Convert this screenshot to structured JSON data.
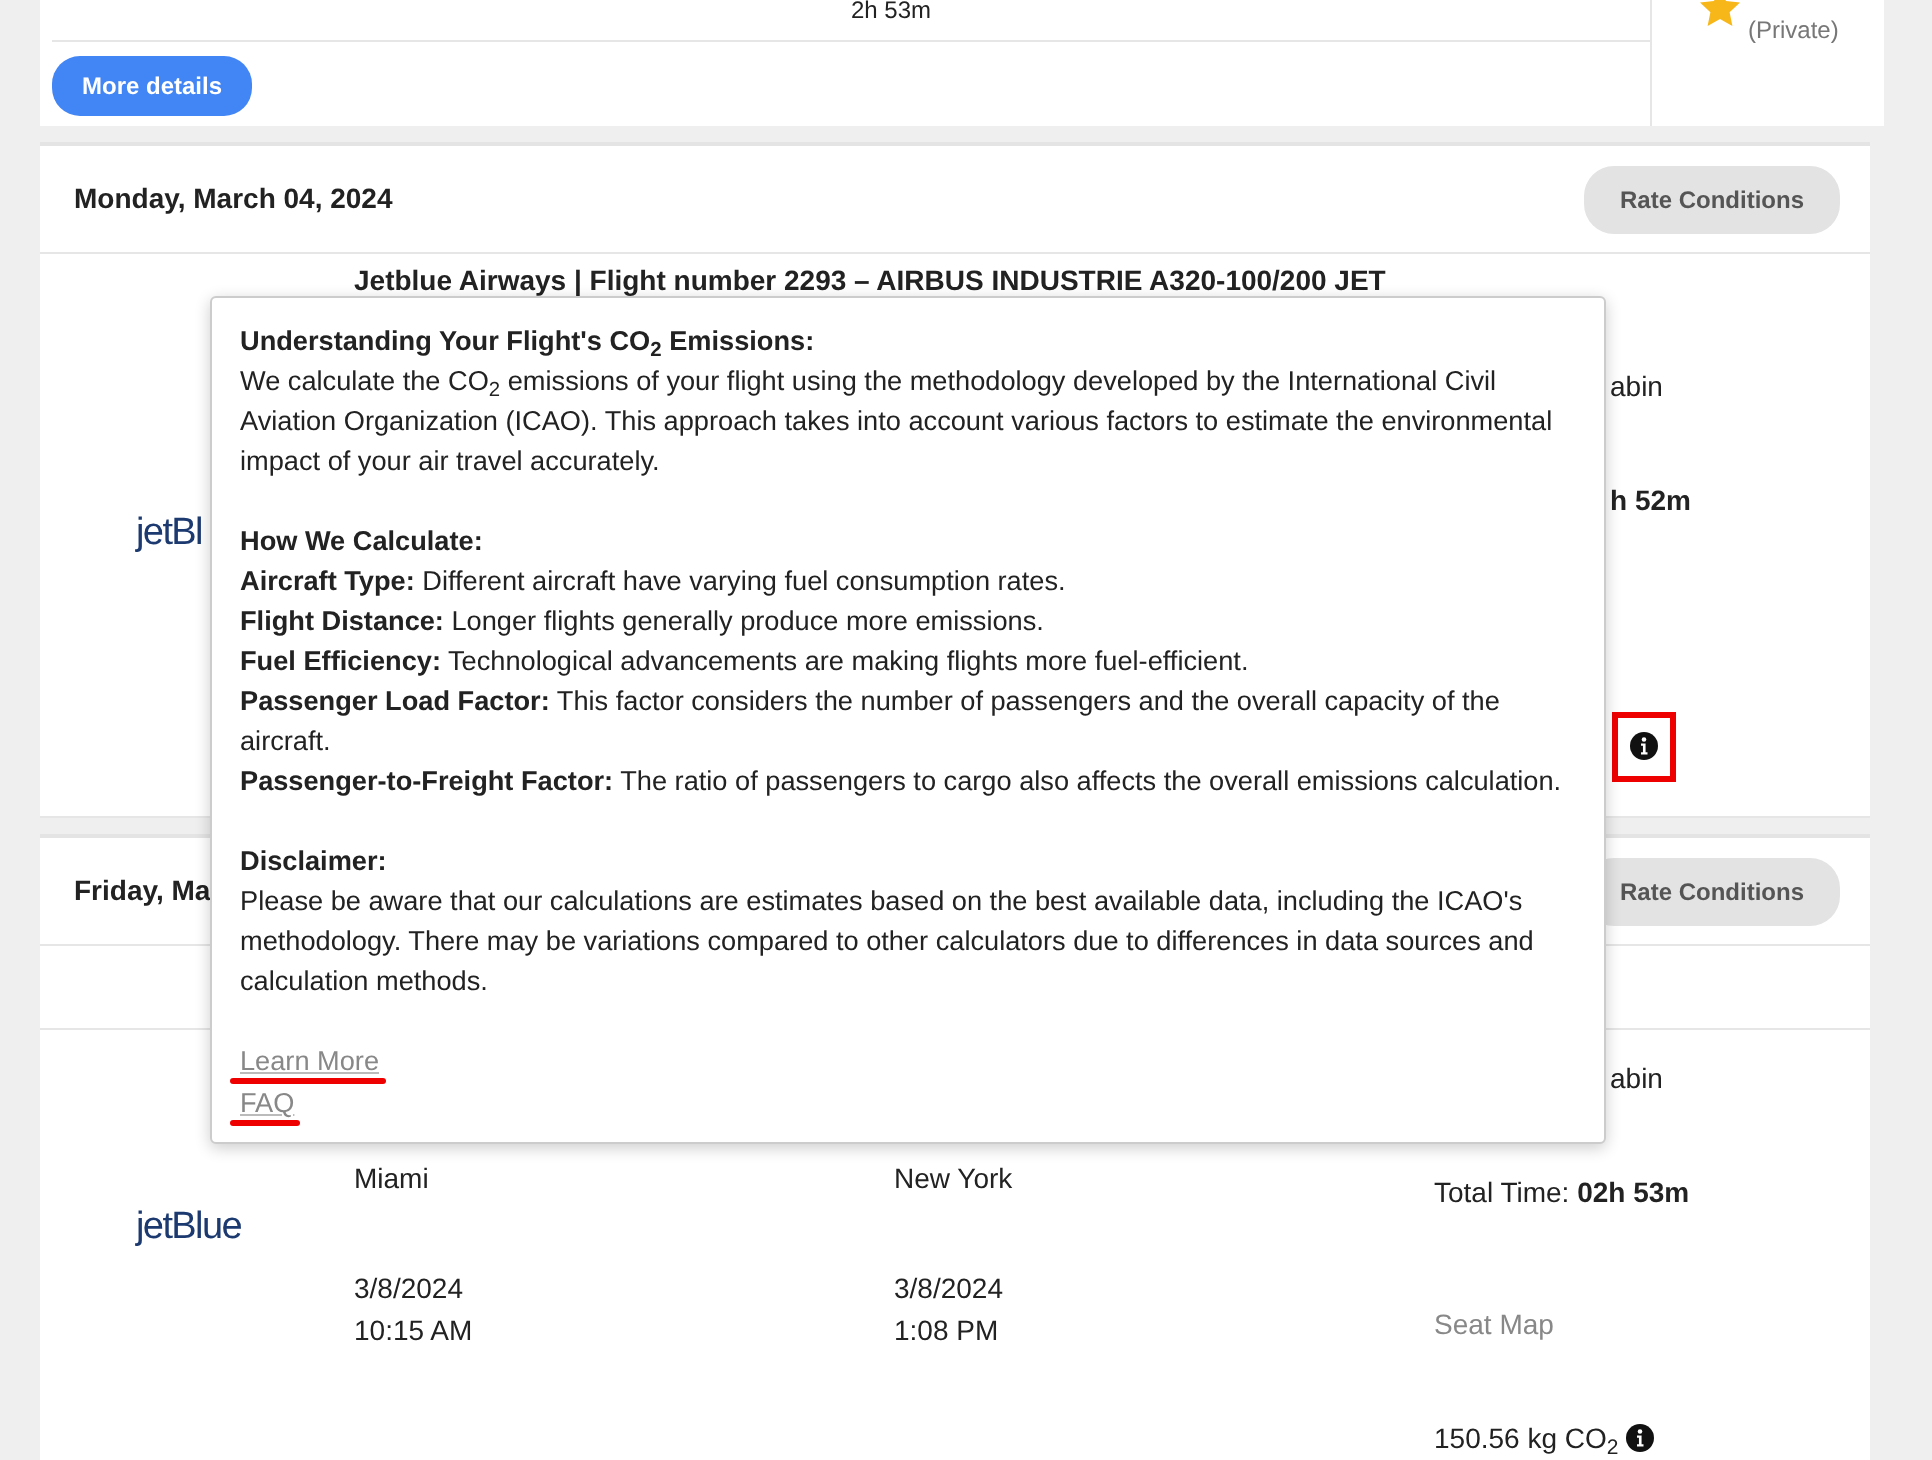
{
  "top_card": {
    "duration": "2h 53m",
    "button": "More details",
    "privacy": "(Private)"
  },
  "days": [
    {
      "date": "Monday, March 04, 2024",
      "rate_button": "Rate Conditions",
      "logo": "jetBl",
      "flight_line": "Jetblue Airways | Flight number 2293 – AIRBUS INDUSTRIE A320-100/200 JET",
      "cabin": "abin",
      "total_time": "h 52m",
      "co2_info": {
        "annotated": true
      }
    },
    {
      "date": "Friday, Ma",
      "rate_button": "Rate Conditions",
      "logo": "jetBlue",
      "cabin": "abin",
      "origin": "Miami",
      "destination": "New York",
      "total_time_label": "Total Time:",
      "total_time": "02h 53m",
      "departure_date": "3/8/2024",
      "departure_time": "10:15 AM",
      "arrival_date": "3/8/2024",
      "arrival_time": "1:08 PM",
      "seat_map": "Seat Map",
      "co2": "150.56 kg CO$_{2}$"
    }
  ],
  "popover": {
    "sections": [
      {
        "heading": "Understanding Your Flight's CO$_{2}$ Emissions:",
        "text": "We calculate the CO$_{2}$ emissions of your flight using the methodology developed by the International Civil Aviation Organization (ICAO). This approach takes into account various factors to estimate the environmental impact of your air travel accurately."
      },
      {
        "heading": "How We Calculate:",
        "factors": [
          "**Aircraft Type:** Different aircraft have varying fuel consumption rates.",
          "**Flight Distance:** Longer flights generally produce more emissions.",
          "**Fuel Efficiency:** Technological advancements are making flights more fuel-efficient.",
          "**Passenger Load Factor:** This factor considers the number of passengers and the overall capacity of the aircraft.",
          "**Passenger-to-Freight Factor:** The ratio of passengers to cargo also affects the overall emissions calculation."
        ]
      },
      {
        "heading": "Disclaimer:",
        "text": "Please be aware that our calculations are estimates based on the best available data, including the ICAO's methodology. There may be variations compared to other calculators due to differences in data sources and calculation methods."
      }
    ],
    "links": [
      {
        "label": "Learn More",
        "annotated": true
      },
      {
        "label": "FAQ",
        "annotated": true
      }
    ]
  }
}
